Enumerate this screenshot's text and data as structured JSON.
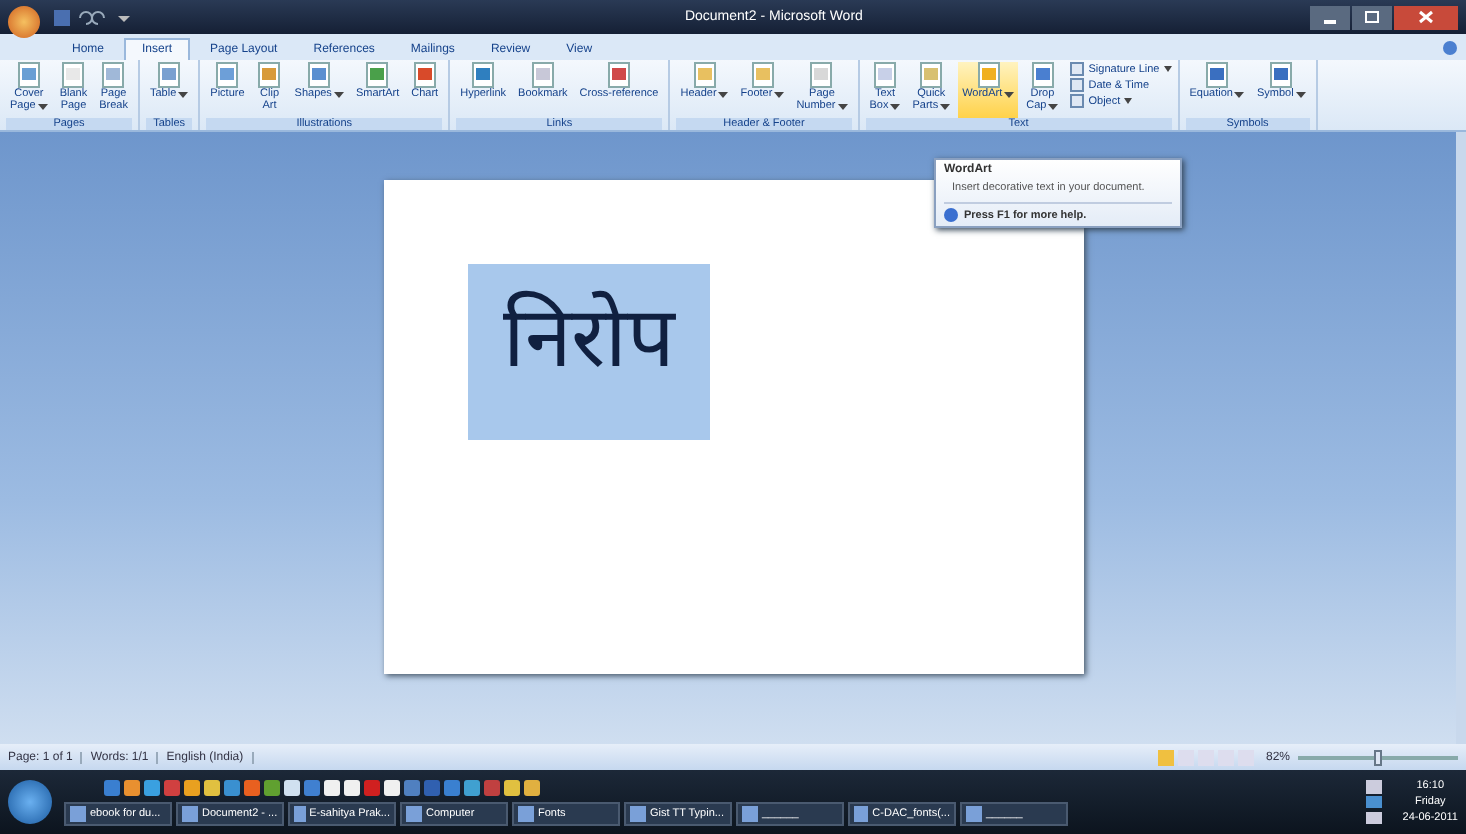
{
  "window": {
    "title": "Document2 - Microsoft Word"
  },
  "tabs": [
    {
      "label": "Home",
      "selected": false
    },
    {
      "label": "Insert",
      "selected": true
    },
    {
      "label": "Page Layout",
      "selected": false
    },
    {
      "label": "References",
      "selected": false
    },
    {
      "label": "Mailings",
      "selected": false
    },
    {
      "label": "Review",
      "selected": false
    },
    {
      "label": "View",
      "selected": false
    }
  ],
  "ribbon_groups": [
    {
      "label": "Pages",
      "buttons": [
        {
          "lines": [
            "Cover",
            "Page"
          ],
          "dropdown": true,
          "hovered": false
        },
        {
          "lines": [
            "Blank",
            "Page"
          ],
          "dropdown": false,
          "hovered": false
        },
        {
          "lines": [
            "Page",
            "Break"
          ],
          "dropdown": false,
          "hovered": false
        }
      ]
    },
    {
      "label": "Tables",
      "buttons": [
        {
          "lines": [
            "Table"
          ],
          "dropdown": true,
          "hovered": false
        }
      ]
    },
    {
      "label": "Illustrations",
      "buttons": [
        {
          "lines": [
            "Picture"
          ],
          "dropdown": false,
          "hovered": false
        },
        {
          "lines": [
            "Clip",
            "Art"
          ],
          "dropdown": false,
          "hovered": false
        },
        {
          "lines": [
            "Shapes"
          ],
          "dropdown": true,
          "hovered": false
        },
        {
          "lines": [
            "SmartArt"
          ],
          "dropdown": false,
          "hovered": false
        },
        {
          "lines": [
            "Chart"
          ],
          "dropdown": false,
          "hovered": false
        }
      ]
    },
    {
      "label": "Links",
      "buttons": [
        {
          "lines": [
            "Hyperlink"
          ],
          "dropdown": false,
          "hovered": false
        },
        {
          "lines": [
            "Bookmark"
          ],
          "dropdown": false,
          "hovered": false
        },
        {
          "lines": [
            "Cross-reference"
          ],
          "dropdown": false,
          "hovered": false
        }
      ]
    },
    {
      "label": "Header & Footer",
      "buttons": [
        {
          "lines": [
            "Header"
          ],
          "dropdown": true,
          "hovered": false
        },
        {
          "lines": [
            "Footer"
          ],
          "dropdown": true,
          "hovered": false
        },
        {
          "lines": [
            "Page",
            "Number"
          ],
          "dropdown": true,
          "hovered": false
        }
      ]
    },
    {
      "label": "Text",
      "buttons": [
        {
          "lines": [
            "Text",
            "Box"
          ],
          "dropdown": true,
          "hovered": false
        },
        {
          "lines": [
            "Quick",
            "Parts"
          ],
          "dropdown": true,
          "hovered": false
        },
        {
          "lines": [
            "WordArt"
          ],
          "dropdown": true,
          "hovered": true
        },
        {
          "lines": [
            "Drop",
            "Cap"
          ],
          "dropdown": true,
          "hovered": false
        }
      ],
      "small_buttons": [
        {
          "label": "Signature Line",
          "dropdown": true
        },
        {
          "label": "Date & Time",
          "dropdown": false
        },
        {
          "label": "Object",
          "dropdown": true
        }
      ]
    },
    {
      "label": "Symbols",
      "buttons": [
        {
          "lines": [
            "Equation"
          ],
          "dropdown": true,
          "hovered": false
        },
        {
          "lines": [
            "Symbol"
          ],
          "dropdown": true,
          "hovered": false
        }
      ]
    }
  ],
  "tooltip": {
    "title": "WordArt",
    "description": "Insert decorative text in your document.",
    "help": "Press F1 for more help."
  },
  "document": {
    "text": "निरोप",
    "selected": true
  },
  "status_bar": {
    "items": [
      "Page: 1 of 1",
      "Words: 1/1",
      "English (India)"
    ],
    "zoom": "82%",
    "zoom_slider": {
      "level": 0.5
    }
  },
  "taskbar": {
    "buttons": [
      {
        "label": "ebook for du..."
      },
      {
        "label": "Document2 - ..."
      },
      {
        "label": "E-sahitya Prak..."
      },
      {
        "label": "Computer"
      },
      {
        "label": "Fonts"
      },
      {
        "label": "Gist TT Typin..."
      },
      {
        "label": "______"
      },
      {
        "label": "C-DAC_fonts(..."
      },
      {
        "label": "______"
      }
    ],
    "clock": {
      "time": "16:10",
      "day": "Friday",
      "date": "24-06-2011"
    }
  }
}
